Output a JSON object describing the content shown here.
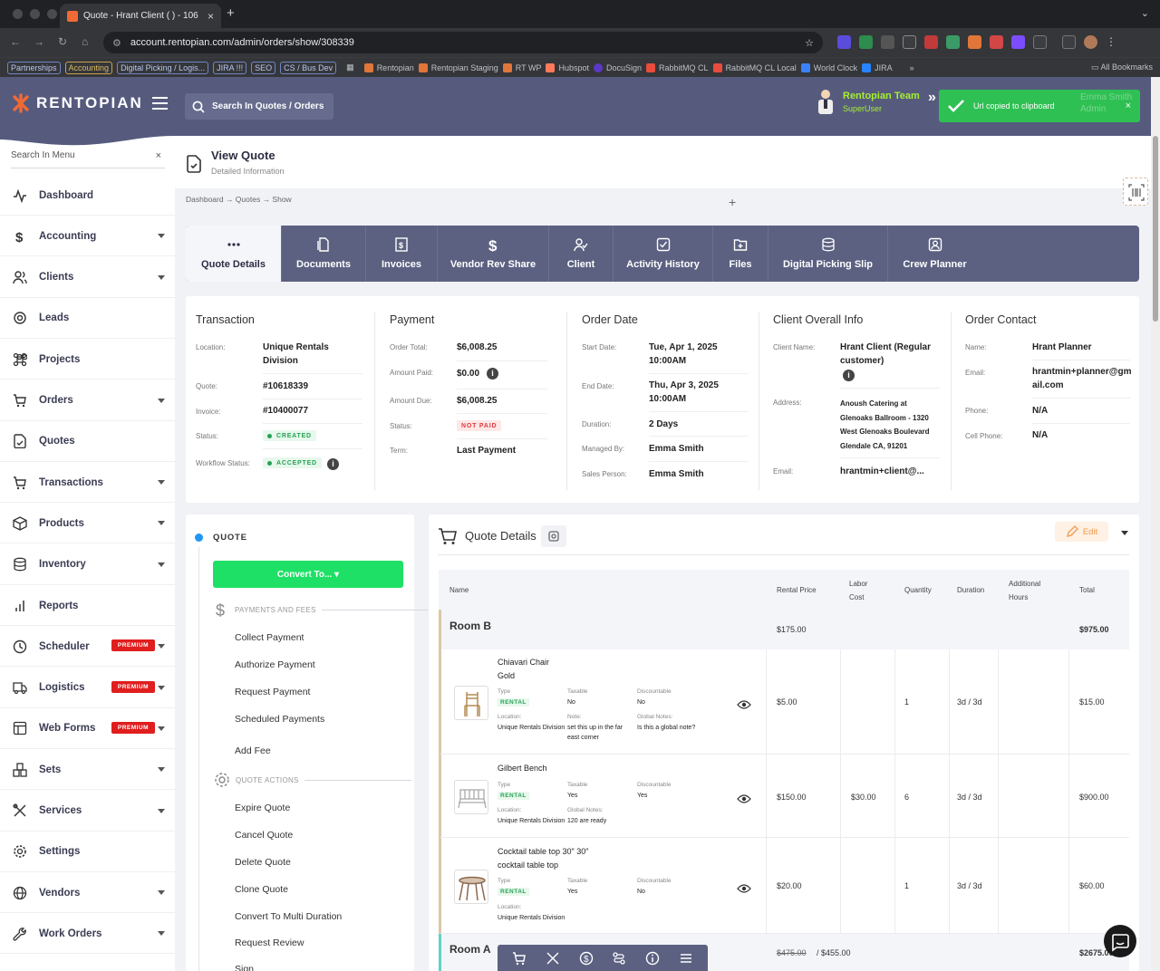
{
  "browser": {
    "tab_title": "Quote - Hrant Client ( ) - 106",
    "url": "account.rentopian.com/admin/orders/show/308339",
    "bookmarks_tagged": [
      "Partnerships",
      "Accounting",
      "Digital Picking / Logis...",
      "JIRA !!!",
      "SEO",
      "CS / Bus Dev"
    ],
    "bookmarks": [
      "Rentopian",
      "Rentopian Staging",
      "RT WP",
      "Hubspot",
      "DocuSign",
      "RabbitMQ CL",
      "RabbitMQ CL Local",
      "World Clock",
      "JIRA"
    ],
    "more": "»",
    "all_bookmarks": "All Bookmarks"
  },
  "header": {
    "brand": "RENTOPIAN",
    "search_label": "Search In Quotes / Orders",
    "user_name": "Rentopian Team",
    "user_role": "SuperUser",
    "toast": "Url copied to clipboard",
    "toast_close": "×",
    "ghost_name": "Emma Smith",
    "ghost_role": "Admin",
    "accent": "#a6ef2f"
  },
  "sidebar": {
    "search_placeholder": "Search In Menu",
    "search_clear": "×",
    "premium_label": "PREMIUM",
    "items": [
      {
        "label": "Dashboard",
        "icon": "pulse-icon",
        "caret": false,
        "premium": false
      },
      {
        "label": "Accounting",
        "icon": "dollar-icon",
        "caret": true,
        "premium": false
      },
      {
        "label": "Clients",
        "icon": "users-icon",
        "caret": true,
        "premium": false
      },
      {
        "label": "Leads",
        "icon": "target-icon",
        "caret": false,
        "premium": false
      },
      {
        "label": "Projects",
        "icon": "command-icon",
        "caret": false,
        "premium": false
      },
      {
        "label": "Orders",
        "icon": "cart-icon",
        "caret": true,
        "premium": false
      },
      {
        "label": "Quotes",
        "icon": "quote-doc-icon",
        "caret": false,
        "premium": false
      },
      {
        "label": "Transactions",
        "icon": "cart-icon",
        "caret": true,
        "premium": false
      },
      {
        "label": "Products",
        "icon": "box-icon",
        "caret": true,
        "premium": false
      },
      {
        "label": "Inventory",
        "icon": "database-icon",
        "caret": true,
        "premium": false
      },
      {
        "label": "Reports",
        "icon": "bar-chart-icon",
        "caret": false,
        "premium": false
      },
      {
        "label": "Scheduler",
        "icon": "clock-icon",
        "caret": true,
        "premium": true
      },
      {
        "label": "Logistics",
        "icon": "truck-icon",
        "caret": true,
        "premium": true
      },
      {
        "label": "Web Forms",
        "icon": "form-icon",
        "caret": true,
        "premium": true
      },
      {
        "label": "Sets",
        "icon": "sets-icon",
        "caret": true,
        "premium": false
      },
      {
        "label": "Services",
        "icon": "tools-icon",
        "caret": true,
        "premium": false
      },
      {
        "label": "Settings",
        "icon": "gear-icon",
        "caret": false,
        "premium": false
      },
      {
        "label": "Vendors",
        "icon": "globe-icon",
        "caret": true,
        "premium": false
      },
      {
        "label": "Work Orders",
        "icon": "wrench-icon",
        "caret": true,
        "premium": false
      }
    ]
  },
  "page": {
    "title": "View Quote",
    "subtitle": "Detailed Information",
    "breadcrumb": "Dashboard → Quotes → Show",
    "plus": "+"
  },
  "tabs": [
    {
      "label": "Quote Details",
      "icon": "dots-icon"
    },
    {
      "label": "Documents",
      "icon": "documents-icon"
    },
    {
      "label": "Invoices",
      "icon": "invoice-icon"
    },
    {
      "label": "Vendor Rev Share",
      "icon": "dollar-icon"
    },
    {
      "label": "Client",
      "icon": "client-icon"
    },
    {
      "label": "Activity History",
      "icon": "checkbox-icon"
    },
    {
      "label": "Files",
      "icon": "file-plus-icon"
    },
    {
      "label": "Digital Picking Slip",
      "icon": "database-icon"
    },
    {
      "label": "Crew Planner",
      "icon": "crew-icon"
    }
  ],
  "transaction": {
    "heading": "Transaction",
    "location_label": "Location:",
    "location": "Unique Rentals Division",
    "quote_label": "Quote:",
    "quote": "#10618339",
    "invoice_label": "Invoice:",
    "invoice": "#10400077",
    "status_label": "Status:",
    "status": "CREATED",
    "workflow_label": "Workflow Status:",
    "workflow": "ACCEPTED"
  },
  "payment": {
    "heading": "Payment",
    "total_label": "Order Total:",
    "total": "$6,008.25",
    "paid_label": "Amount Paid:",
    "paid": "$0.00",
    "due_label": "Amount Due:",
    "due": "$6,008.25",
    "status_label": "Status:",
    "status": "NOT PAID",
    "term_label": "Term:",
    "term": "Last Payment"
  },
  "order_date": {
    "heading": "Order Date",
    "start_label": "Start Date:",
    "start": "Tue, Apr 1, 2025 10:00AM",
    "end_label": "End Date:",
    "end": "Thu, Apr 3, 2025 10:00AM",
    "duration_label": "Duration:",
    "duration": "2 Days",
    "managed_label": "Managed By:",
    "managed": "Emma Smith",
    "sales_label": "Sales Person:",
    "sales": "Emma Smith"
  },
  "client_info": {
    "heading": "Client Overall Info",
    "name_label": "Client Name:",
    "name": "Hrant Client (Regular customer)",
    "address_label": "Address:",
    "address": "Anoush Catering at Glenoaks Ballroom - 1320 West Glenoaks Boulevard Glendale CA, 91201",
    "email_label": "Email:",
    "email": "hrantmin+client@..."
  },
  "order_contact": {
    "heading": "Order Contact",
    "name_label": "Name:",
    "name": "Hrant Planner",
    "email_label": "Email:",
    "email": "hrantmin+planner@gmail.com",
    "phone_label": "Phone:",
    "phone": "N/A",
    "cell_label": "Cell Phone:",
    "cell": "N/A"
  },
  "actions": {
    "quote_label": "QUOTE",
    "convert": "Convert To... ▾",
    "payments_head": "PAYMENTS AND FEES",
    "payments": [
      "Collect Payment",
      "Authorize Payment",
      "Request Payment",
      "Scheduled Payments",
      "Add Fee"
    ],
    "quote_actions_head": "QUOTE ACTIONS",
    "quote_actions": [
      "Expire Quote",
      "Cancel Quote",
      "Delete Quote",
      "Clone Quote",
      "Convert To Multi Duration",
      "Request Review",
      "Sign"
    ]
  },
  "quote_details": {
    "title": "Quote Details",
    "edit": "Edit",
    "columns": [
      "Name",
      "Rental Price",
      "Labor Cost",
      "Quantity",
      "Duration",
      "Additional Hours",
      "Total"
    ],
    "rooms": [
      {
        "name": "Room B",
        "rental": "$175.00",
        "total": "$975.00",
        "items": [
          {
            "name": "Chiavari Chair Gold",
            "thumb": "chair-thumbnail",
            "type": "RENTAL",
            "taxable": "No",
            "discountable": "No",
            "location": "Unique Rentals Division",
            "note_label": "Note:",
            "note": "set this up in the far east corner",
            "global_label": "Global Notes:",
            "global": "Is this a global note?",
            "rental": "$5.00",
            "labor": "",
            "qty": "1",
            "duration": "3d / 3d",
            "hours": "",
            "total": "$15.00"
          },
          {
            "name": "Gilbert Bench",
            "thumb": "bench-thumbnail",
            "type": "RENTAL",
            "taxable": "Yes",
            "discountable": "Yes",
            "location": "Unique Rentals Division",
            "note_label": "Global Notes:",
            "note": "120 are ready",
            "global_label": "",
            "global": "",
            "rental": "$150.00",
            "labor": "$30.00",
            "qty": "6",
            "duration": "3d / 3d",
            "hours": "",
            "total": "$900.00"
          },
          {
            "name": "Cocktail table top 30\" 30\" cocktail table top",
            "thumb": "table-thumbnail",
            "type": "RENTAL",
            "taxable": "Yes",
            "discountable": "No",
            "location": "Unique Rentals Division",
            "note_label": "",
            "note": "",
            "global_label": "",
            "global": "",
            "rental": "$20.00",
            "labor": "",
            "qty": "1",
            "duration": "3d / 3d",
            "hours": "",
            "total": "$60.00"
          }
        ]
      },
      {
        "name": "Room A",
        "rental_old": "$475.00",
        "rental": "/ $455.00",
        "total": "$2675.00"
      }
    ],
    "sub_labels": {
      "type": "Type",
      "taxable": "Taxable",
      "discountable": "Discountable",
      "location": "Location:"
    }
  },
  "floating_bar": [
    "cart-icon",
    "tools-icon",
    "dollar-circle-icon",
    "route-icon",
    "info-icon",
    "menu-icon"
  ]
}
